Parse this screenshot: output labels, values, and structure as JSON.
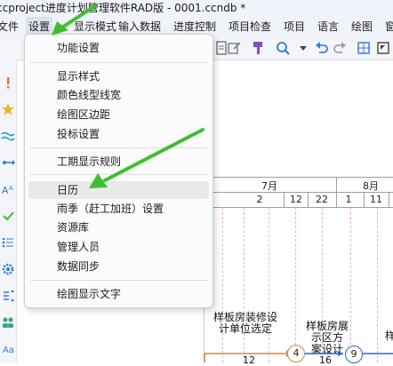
{
  "window": {
    "title": "ccproject进度计划管理软件RAD版 - 0001.ccndb *"
  },
  "menubar": {
    "items": [
      {
        "label": "文件"
      },
      {
        "label": "设置"
      },
      {
        "label": "显示模式"
      },
      {
        "label": "输入数据"
      },
      {
        "label": "进度控制"
      },
      {
        "label": "项目检查"
      },
      {
        "label": "项目"
      },
      {
        "label": "语言"
      },
      {
        "label": "绘图"
      },
      {
        "label": "窗"
      }
    ],
    "active": "设置"
  },
  "settings_menu": {
    "items": [
      {
        "label": "功能设置"
      },
      {
        "label": "显示样式"
      },
      {
        "label": "颜色线型线宽"
      },
      {
        "label": "绘图区边距"
      },
      {
        "label": "投标设置"
      },
      {
        "label": "工期显示规则"
      },
      {
        "label": "日历"
      },
      {
        "label": "雨季（赶工加班）设置"
      },
      {
        "label": "资源库"
      },
      {
        "label": "管理人员"
      },
      {
        "label": "数据同步"
      },
      {
        "label": "绘图显示文字"
      }
    ],
    "highlighted": "日历"
  },
  "gantt": {
    "months": [
      {
        "label": "7月"
      },
      {
        "label": "8月"
      }
    ],
    "days": [
      {
        "label": "2"
      },
      {
        "label": "12"
      },
      {
        "label": "22"
      },
      {
        "label": "1"
      },
      {
        "label": "11"
      }
    ],
    "tasks": [
      {
        "label_line1": "样板房装修设",
        "label_line2": "计单位选定",
        "duration": "12"
      },
      {
        "label_line1": "样板房展",
        "label_line2": "示区方",
        "label_line3": "案设计",
        "duration": "16"
      },
      {
        "label_line1": "样"
      }
    ],
    "nodes": [
      {
        "number": "4"
      },
      {
        "number": "9"
      }
    ]
  },
  "colors": {
    "annotation_arrow": "#3fbf2f",
    "node_orange": "#d58a3a",
    "node_blue": "#2f63c9"
  }
}
